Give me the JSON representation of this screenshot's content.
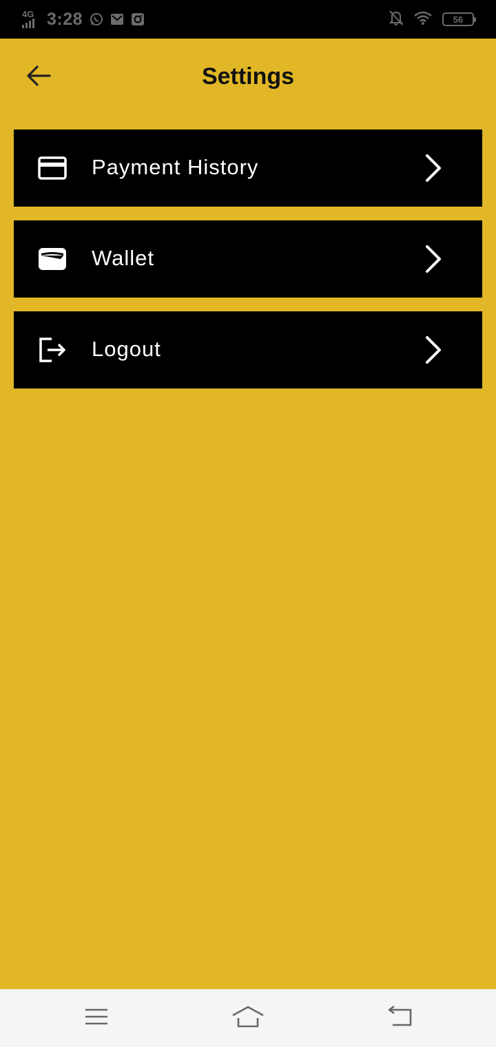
{
  "status_bar": {
    "network": "4G",
    "time": "3:28",
    "battery": "56",
    "icons": [
      "whatsapp-icon",
      "gmail-icon",
      "instagram-icon",
      "bell-off-icon",
      "wifi-icon",
      "battery-icon"
    ]
  },
  "header": {
    "title": "Settings",
    "back_icon": "arrow-left-icon"
  },
  "menu": {
    "items": [
      {
        "label": "Payment History",
        "icon": "credit-card-icon"
      },
      {
        "label": "Wallet",
        "icon": "wallet-icon"
      },
      {
        "label": "Logout",
        "icon": "logout-icon"
      }
    ],
    "chevron_icon": "chevron-right-icon"
  },
  "nav_bar": {
    "icons": [
      "menu-icon",
      "home-icon",
      "back-icon"
    ]
  },
  "colors": {
    "background": "#E1B727",
    "item_background": "#000000",
    "item_text": "#FFFFFF",
    "title_text": "#111111",
    "nav_background": "#F5F5F5"
  }
}
